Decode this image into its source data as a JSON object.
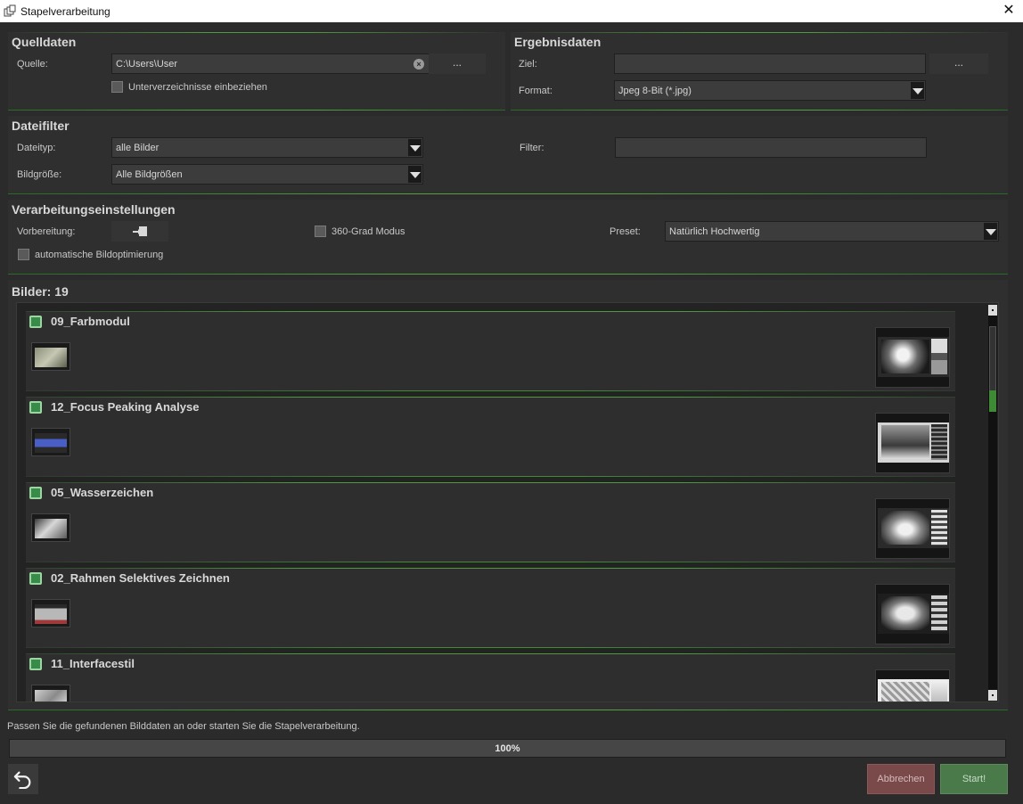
{
  "window": {
    "title": "Stapelverarbeitung"
  },
  "source": {
    "title": "Quelldaten",
    "source_label": "Quelle:",
    "source_value": "C:\\Users\\User",
    "browse_label": "...",
    "subdirs_label": "Unterverzeichnisse einbeziehen",
    "subdirs_checked": false
  },
  "result": {
    "title": "Ergebnisdaten",
    "target_label": "Ziel:",
    "target_value": "",
    "browse_label": "...",
    "format_label": "Format:",
    "format_value": "Jpeg 8-Bit (*.jpg)"
  },
  "filter": {
    "title": "Dateifilter",
    "filetype_label": "Dateityp:",
    "filetype_value": "alle Bilder",
    "size_label": "Bildgröße:",
    "size_value": "Alle Bildgrößen",
    "filter_label": "Filter:",
    "filter_value": ""
  },
  "processing": {
    "title": "Verarbeitungseinstellungen",
    "prep_label": "Vorbereitung:",
    "mode360_label": "360-Grad Modus",
    "mode360_checked": false,
    "auto_opt_label": "automatische Bildoptimierung",
    "auto_opt_checked": false,
    "preset_label": "Preset:",
    "preset_value": "Natürlich Hochwertig"
  },
  "images": {
    "header": "Bilder: 19",
    "items": [
      {
        "name": "09_Farbmodul"
      },
      {
        "name": "12_Focus Peaking Analyse"
      },
      {
        "name": "05_Wasserzeichen"
      },
      {
        "name": "02_Rahmen Selektives Zeichnen"
      },
      {
        "name": "11_Interfacestil"
      }
    ]
  },
  "status": {
    "message": "Passen Sie die gefundenen Bilddaten an oder starten Sie die Stapelverarbeitung.",
    "progress_text": "100%",
    "progress_value": 1.0
  },
  "buttons": {
    "cancel": "Abbrechen",
    "start": "Start!"
  },
  "colors": {
    "accent_green": "#4f9a3f",
    "cancel_bg": "#7a4a4a",
    "start_bg": "#4a7a4a"
  }
}
